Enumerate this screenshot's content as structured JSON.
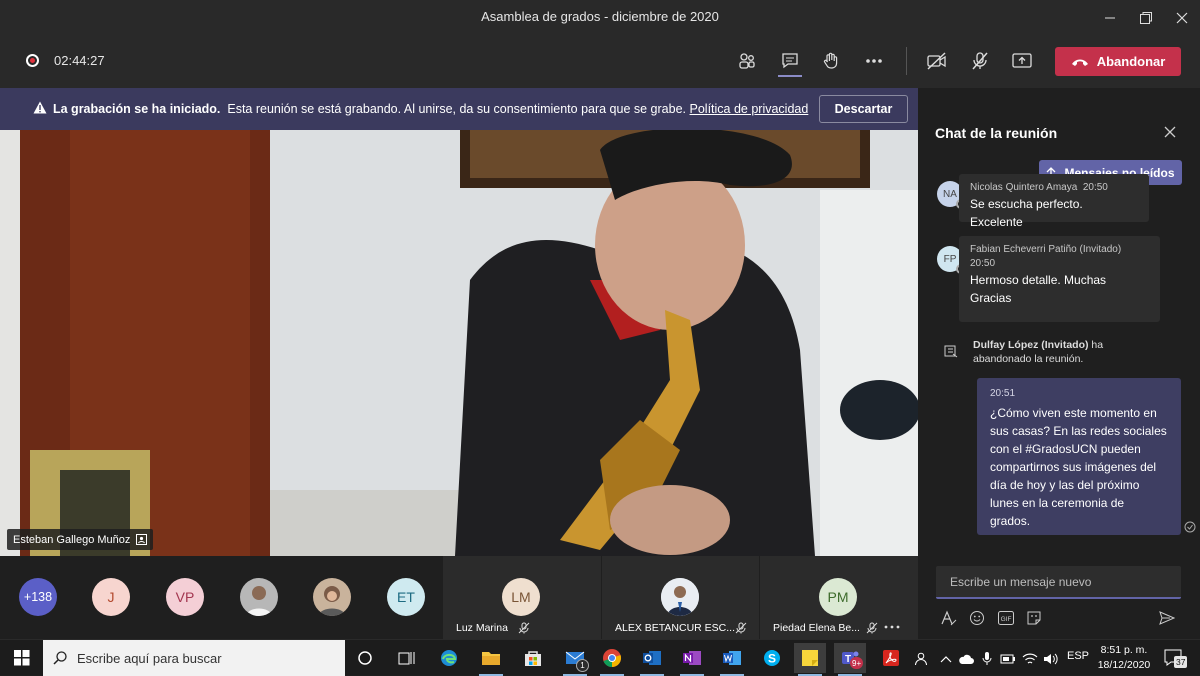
{
  "window": {
    "title": "Asamblea de grados - diciembre de 2020"
  },
  "toolbar": {
    "timer": "02:44:27",
    "leave_label": "Abandonar"
  },
  "banner": {
    "bold_text": "La grabación se ha iniciado.",
    "text": "Esta reunión se está grabando. Al unirse, da su consentimiento para que se grabe.",
    "link": "Política de privacidad",
    "dismiss_label": "Descartar"
  },
  "video": {
    "speaker_name": "Esteban Gallego Muñoz"
  },
  "participants": {
    "overflow": "+138",
    "avatars": [
      {
        "initials": "J",
        "bg": "#f7d5cf",
        "fg": "#b34a2f"
      },
      {
        "initials": "VP",
        "bg": "#f4cfd6",
        "fg": "#a33650"
      },
      {
        "initials": "",
        "bg": "#b7b7b7",
        "fg": "#333"
      },
      {
        "initials": "",
        "bg": "#c9b39c",
        "fg": "#333"
      },
      {
        "initials": "ET",
        "bg": "#cfeaf0",
        "fg": "#1d6b82"
      }
    ],
    "tiles": [
      {
        "initials": "LM",
        "name": "Luz Marina",
        "bg": "#efdfcf",
        "fg": "#7a5536"
      },
      {
        "initials": "",
        "name": "ALEX BETANCUR ESC...",
        "bg": "#e9edf2",
        "fg": "#333"
      },
      {
        "initials": "PM",
        "name": "Piedad Elena Be...",
        "bg": "#dbe9d3",
        "fg": "#3d6b2b"
      }
    ]
  },
  "chat": {
    "title": "Chat de la reunión",
    "unread_label": "Mensajes no leídos",
    "messages": [
      {
        "initials": "NA",
        "author": "Nicolas Quintero Amaya",
        "time": "20:50",
        "text": "Se escucha perfecto. Excelente"
      },
      {
        "initials": "FP",
        "author": "Fabian Echeverri Patiño (Invitado)",
        "time": "20:50",
        "text_line1": "Hermoso detalle. Muchas",
        "text_line2": "Gracias"
      }
    ],
    "event": {
      "name": "Dulfay López (Invitado)",
      "suffix": "ha",
      "line2": "abandonado la reunión."
    },
    "my_message": {
      "time": "20:51",
      "lines": [
        "¿Cómo viven este momento en",
        "sus casas? En las redes  sociales",
        "con el #GradosUCN pueden",
        "compartirnos sus imágenes del",
        "día de hoy y las del próximo",
        "lunes en la ceremonia de",
        "grados."
      ]
    },
    "compose_placeholder": "Escribe un mensaje nuevo"
  },
  "taskbar": {
    "search_placeholder": "Escribe aquí para buscar",
    "language": "ESP",
    "time": "8:51 p. m.",
    "date": "18/12/2020",
    "notifications": "37",
    "teams_badge": "9+",
    "mail_badge": "1"
  },
  "colors": {
    "accent": "#6264a7",
    "leave": "#c4314b",
    "banner": "#3b3a5e"
  }
}
